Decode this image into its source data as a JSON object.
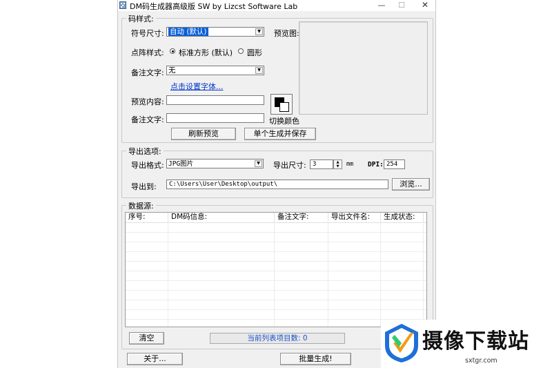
{
  "window": {
    "title": "DM码生成器高级版 SW  by Lizcst Software Lab",
    "min_glyph": "—",
    "max_glyph": "☐",
    "close_glyph": "✕"
  },
  "code_style": {
    "legend": "码样式:",
    "symbol_size_label": "符号尺寸:",
    "symbol_size_value": "自动 (默认)",
    "dot_style_label": "点阵样式:",
    "dot_square_label": "标准方形 (默认)",
    "dot_circle_label": "圆形",
    "note_text_label": "备注文字:",
    "note_text_value": "无",
    "font_link": "点击设置字体...",
    "preview_content_label": "预览内容:",
    "preview_content_value": "",
    "note_text2_label": "备注文字:",
    "note_text2_value": "",
    "color_button_label": "切换颜色",
    "refresh_button": "刷新预览",
    "save_single_button": "单个生成并保存",
    "preview_label": "预览图:"
  },
  "export": {
    "legend": "导出选项:",
    "format_label": "导出格式:",
    "format_value": "JPG图片",
    "size_label": "导出尺寸:",
    "size_value": "3",
    "size_unit": "mm",
    "dpi_label": "DPI:",
    "dpi_value": "254",
    "path_label": "导出到:",
    "path_value": "C:\\Users\\User\\Desktop\\output\\",
    "browse_button": "浏览..."
  },
  "datasource": {
    "legend": "数据源:",
    "columns": [
      "序号:",
      "DM码信息:",
      "备注文字:",
      "导出文件名:",
      "生成状态:"
    ],
    "clear_button": "清空",
    "status_text": "当前列表项目数: 0"
  },
  "footer": {
    "about_button": "关于...",
    "batch_button": "批量生成!"
  },
  "watermark": {
    "brand": "摄像下载站",
    "url": "sxtgr.com"
  },
  "colors": {
    "window_bg": "#f0f0f0",
    "selection": "#0a5fd8",
    "link": "#0033cc",
    "status_text": "#1a52c9"
  }
}
